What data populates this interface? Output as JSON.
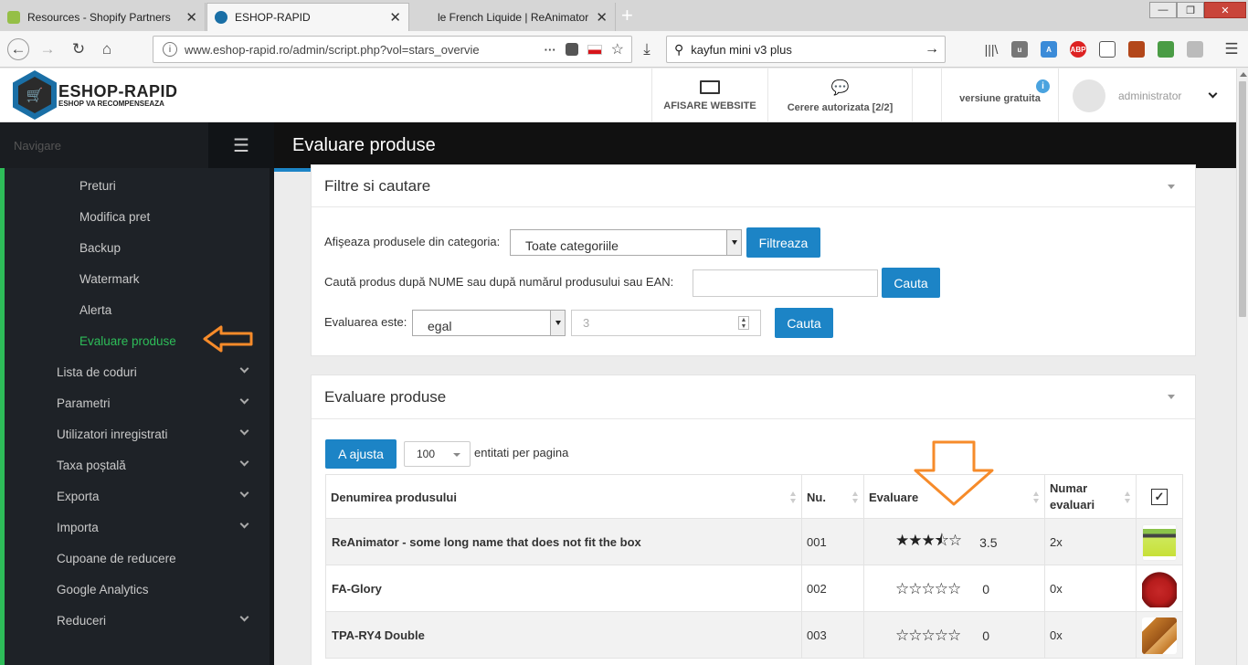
{
  "browser": {
    "tabs": [
      {
        "title": "Resources - Shopify Partners"
      },
      {
        "title": "ESHOP-RAPID"
      },
      {
        "title": "le French Liquide | ReAnimator"
      }
    ],
    "url": "www.eshop-rapid.ro/admin/script.php?vol=stars_overvie",
    "search_query": "kayfun mini v3 plus"
  },
  "header": {
    "logo_title": "ESHOP-RAPID",
    "logo_subtitle": "ESHOP VA RECOMPENSEAZA",
    "show_website": "AFISARE WEBSITE",
    "auth_requests": "Cerere autorizata [2/2]",
    "version": "versiune gratuita",
    "user": "administrator"
  },
  "sidebar": {
    "title": "Navigare",
    "items": [
      {
        "label": "Preturi",
        "level": 2,
        "expandable": false,
        "active": false
      },
      {
        "label": "Modifica pret",
        "level": 2,
        "expandable": false,
        "active": false
      },
      {
        "label": "Backup",
        "level": 2,
        "expandable": false,
        "active": false
      },
      {
        "label": "Watermark",
        "level": 2,
        "expandable": false,
        "active": false
      },
      {
        "label": "Alerta",
        "level": 2,
        "expandable": false,
        "active": false
      },
      {
        "label": "Evaluare produse",
        "level": 2,
        "expandable": false,
        "active": true
      },
      {
        "label": "Lista de coduri",
        "level": 1,
        "expandable": true,
        "active": false
      },
      {
        "label": "Parametri",
        "level": 1,
        "expandable": true,
        "active": false
      },
      {
        "label": "Utilizatori inregistrati",
        "level": 1,
        "expandable": true,
        "active": false
      },
      {
        "label": "Taxa poștală",
        "level": 1,
        "expandable": true,
        "active": false
      },
      {
        "label": "Exporta",
        "level": 1,
        "expandable": true,
        "active": false
      },
      {
        "label": "Importa",
        "level": 1,
        "expandable": true,
        "active": false
      },
      {
        "label": "Cupoane de reducere",
        "level": 1,
        "expandable": false,
        "active": false
      },
      {
        "label": "Google Analytics",
        "level": 1,
        "expandable": false,
        "active": false
      },
      {
        "label": "Reduceri",
        "level": 1,
        "expandable": true,
        "active": false
      }
    ],
    "accent_color": "#2ebd59"
  },
  "main": {
    "page_title": "Evaluare produse",
    "filters": {
      "title": "Filtre si cautare",
      "category_label": "Afişeaza produsele din categoria:",
      "category_value": "Toate categoriile",
      "filter_button": "Filtreaza",
      "search_label": "Caută produs după NUME sau după numărul produsului sau EAN:",
      "search_value": "",
      "search_button": "Cauta",
      "rating_label": "Evaluarea este:",
      "rating_operator": "egal",
      "rating_value": "3",
      "rating_button": "Cauta"
    },
    "products": {
      "title": "Evaluare produse",
      "adjust_button": "A ajusta",
      "per_page": "100",
      "per_page_label": "entitati per pagina",
      "columns": [
        "Denumirea produsului",
        "Nu.",
        "Evaluare",
        "Numar evaluari"
      ],
      "rows": [
        {
          "name": "ReAnimator - some long name that does not fit the box",
          "no": "001",
          "rating": "3.5",
          "count": "2x",
          "stars": 3.5
        },
        {
          "name": "FA-Glory",
          "no": "002",
          "rating": "0",
          "count": "0x",
          "stars": 0
        },
        {
          "name": "TPA-RY4 Double",
          "no": "003",
          "rating": "0",
          "count": "0x",
          "stars": 0
        }
      ]
    }
  },
  "colors": {
    "primary": "#1c84c6",
    "annotation_arrow": "#f68b2a"
  }
}
